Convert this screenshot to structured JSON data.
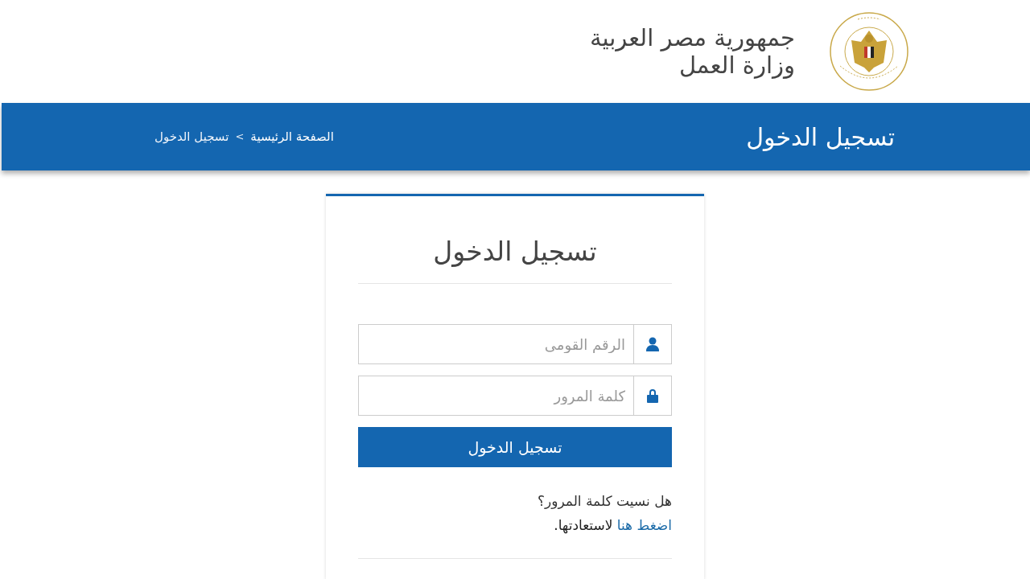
{
  "header": {
    "title_line_1": "جمهورية مصر العربية",
    "title_line_2": "وزارة العمل"
  },
  "banner": {
    "title": "تسجيل الدخول",
    "breadcrumb": [
      {
        "label": "الصفحة الرئيسية",
        "kind": "link"
      },
      {
        "label": ">",
        "kind": "separator"
      },
      {
        "label": "تسجيل الدخول",
        "kind": "current"
      }
    ]
  },
  "login": {
    "title": "تسجيل الدخول",
    "fields": [
      {
        "kind": "user",
        "placeholder": "الرقم القومى"
      },
      {
        "kind": "password",
        "placeholder": "كلمة المرور"
      }
    ],
    "submit": "تسجيل الدخول",
    "forgot_question": "هل نسيت كلمة المرور؟",
    "recover_link": "اضغط هنا",
    "recover_text": "لاستعادتها."
  }
}
